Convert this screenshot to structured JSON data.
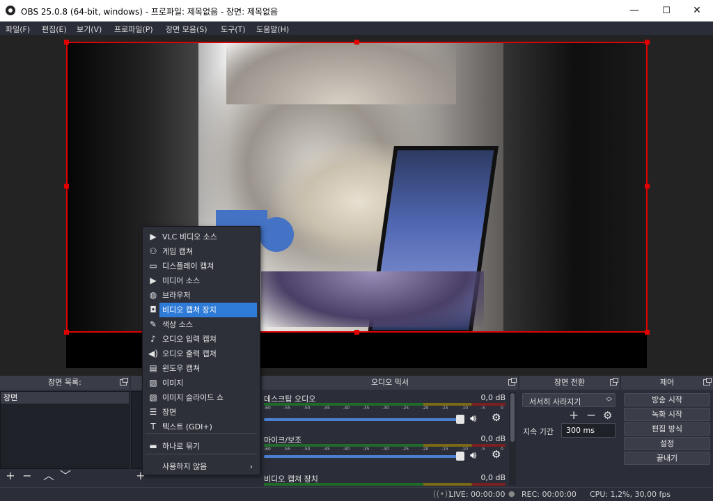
{
  "window": {
    "title": "OBS 25.0.8 (64-bit, windows) - 프로파일: 제목없음 - 장면: 제목없음",
    "min": "—",
    "max": "☐",
    "close": "✕"
  },
  "menu": [
    "파일(F)",
    "편집(E)",
    "보기(V)",
    "프로파일(P)",
    "장면 모음(S)",
    "도구(T)",
    "도움말(H)"
  ],
  "docks": {
    "scenes": {
      "title": "장면 목록:",
      "items": [
        "장면"
      ]
    },
    "mixer": {
      "title": "오디오 믹서",
      "channels": [
        {
          "name": "데스크탑 오디오",
          "db": "0,0 dB",
          "level": 0.0
        },
        {
          "name": "마이크/보조",
          "db": "0,0 dB",
          "level": 0.0
        },
        {
          "name": "비디오 캡쳐 장치",
          "db": "0,0 dB",
          "level": 0.0
        }
      ],
      "scale": [
        "-60",
        "-55",
        "-50",
        "-45",
        "-40",
        "-35",
        "-30",
        "-25",
        "-20",
        "-15",
        "-10",
        "-5",
        "0"
      ]
    },
    "transitions": {
      "title": "장면 전환",
      "selected": "서서히 사라지기",
      "duration_label": "지속 기간",
      "duration": "300 ms"
    },
    "controls": {
      "title": "제어",
      "buttons": [
        "방송 시작",
        "녹화 시작",
        "편집 방식",
        "설정",
        "끝내기"
      ]
    }
  },
  "context_menu": {
    "items": [
      {
        "icon": "play-icon",
        "glyph": "▶",
        "label": "VLC 비디오 소스"
      },
      {
        "icon": "gamepad-icon",
        "glyph": "⚇",
        "label": "게임 캡쳐"
      },
      {
        "icon": "monitor-icon",
        "glyph": "▭",
        "label": "디스플레이 캡쳐"
      },
      {
        "icon": "play-icon",
        "glyph": "▶",
        "label": "미디어 소스"
      },
      {
        "icon": "globe-icon",
        "glyph": "◍",
        "label": "브라우저"
      },
      {
        "icon": "camera-icon",
        "glyph": "◘",
        "label": "비디오 캡쳐 장치",
        "highlighted": true
      },
      {
        "icon": "brush-icon",
        "glyph": "✎",
        "label": "색상 소스"
      },
      {
        "icon": "microphone-icon",
        "glyph": "♪",
        "label": "오디오 입력 캡쳐"
      },
      {
        "icon": "speaker-icon",
        "glyph": "◀)",
        "label": "오디오 출력 캡쳐"
      },
      {
        "icon": "window-icon",
        "glyph": "▤",
        "label": "윈도우 캡쳐"
      },
      {
        "icon": "image-icon",
        "glyph": "▨",
        "label": "이미지"
      },
      {
        "icon": "slideshow-icon",
        "glyph": "▧",
        "label": "이미지 슬라이드 쇼"
      },
      {
        "icon": "list-icon",
        "glyph": "☰",
        "label": "장면"
      },
      {
        "icon": "text-icon",
        "glyph": "T",
        "label": "텍스트 (GDI+)"
      },
      {
        "icon": "folder-icon",
        "glyph": "▬",
        "label": "하나로 묶기"
      },
      {
        "icon": "",
        "glyph": "",
        "label": "사용하지 않음",
        "submenu": "›"
      }
    ]
  },
  "status": {
    "live": "LIVE: 00:00:00",
    "rec": "REC: 00:00:00",
    "cpu": "CPU: 1,2%, 30,00 fps"
  },
  "colors": {
    "selection": "#e00000",
    "shape": "#4472c4",
    "highlight": "#2f7bd8"
  }
}
